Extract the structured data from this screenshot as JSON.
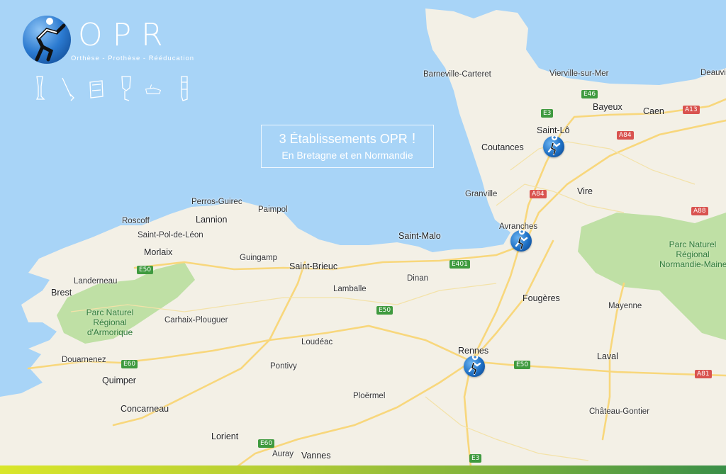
{
  "logo": {
    "title": "OPR",
    "subtitle": "Orthèse - Prothèse - Rééducation"
  },
  "tools": [
    "prosthetic-leg-icon",
    "crutch-icon",
    "brace-icon",
    "knee-orthosis-icon",
    "ankle-foot-icon",
    "leg-brace-icon"
  ],
  "banner": {
    "line1": "3 Établissements OPR",
    "exclaim": "!",
    "line2": "En Bretagne et en Normandie"
  },
  "cities": {
    "barneville": "Barneville-Carteret",
    "vierville": "Vierville-sur-Mer",
    "deauville": "Deauvil",
    "bayeux": "Bayeux",
    "caen": "Caen",
    "saintlo": "Saint-Lô",
    "coutances": "Coutances",
    "granville": "Granville",
    "vire": "Vire",
    "avranches": "Avranches",
    "saintmalo": "Saint-Malo",
    "perros": "Perros-Guirec",
    "paimpol": "Paimpol",
    "lannion": "Lannion",
    "roscoff": "Roscoff",
    "stpol": "Saint-Pol-de-Léon",
    "morlaix": "Morlaix",
    "guingamp": "Guingamp",
    "stbrieuc": "Saint-Brieuc",
    "landerneau": "Landerneau",
    "brest": "Brest",
    "lamballe": "Lamballe",
    "dinan": "Dinan",
    "fougeres": "Fougères",
    "mayenne": "Mayenne",
    "carhaix": "Carhaix-Plouguer",
    "loudeac": "Loudéac",
    "rennes": "Rennes",
    "laval": "Laval",
    "douarnenez": "Douarnenez",
    "pontivy": "Pontivy",
    "quimper": "Quimper",
    "ploermel": "Ploërmel",
    "concarneau": "Concarneau",
    "chateau": "Château-Gontier",
    "lorient": "Lorient",
    "auray": "Auray",
    "vannes": "Vannes"
  },
  "parks": {
    "armorique": "Parc Naturel\nRégional\nd'Armorique",
    "normandie": "Parc Naturel\nRégional\nNormandie-Maine"
  },
  "roads": {
    "e46": "E46",
    "e3_top": "E3",
    "a13": "A13",
    "a84_top": "A84",
    "a84_mid": "A84",
    "a88": "A88",
    "e50_morlaix": "E50",
    "e401": "E401",
    "e50_lamballe": "E50",
    "e60_west": "E60",
    "e50_rennes": "E50",
    "a81": "A81",
    "e60_south": "E60",
    "e3_bottom": "E3"
  },
  "colors": {
    "sea": "#a8d4f7",
    "land": "#f3f0e6",
    "park": "#bfe0a5",
    "road": "#f8d77c",
    "brand_blue": "#1d6fc4"
  }
}
